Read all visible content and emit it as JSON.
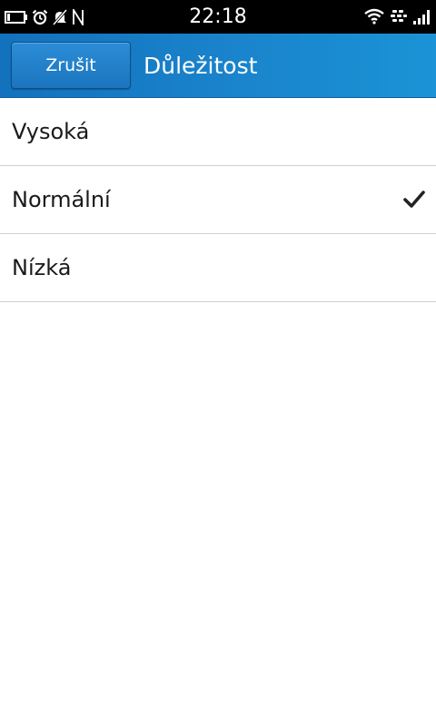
{
  "status_bar": {
    "time": "22:18",
    "left_icons": [
      "battery-icon",
      "alarm-icon",
      "notifications-muted-icon",
      "nfc-icon"
    ],
    "right_icons": [
      "wifi-icon",
      "bbm-icon",
      "signal-icon"
    ]
  },
  "header": {
    "cancel_label": "Zrušit",
    "title": "Důležitost"
  },
  "options": [
    {
      "label": "Vysoká",
      "selected": false
    },
    {
      "label": "Normální",
      "selected": true
    },
    {
      "label": "Nízká",
      "selected": false
    }
  ],
  "colors": {
    "header_bg": "#1a84cc",
    "status_bg": "#000000",
    "divider": "#cfcfcf",
    "text": "#1a1a1a"
  }
}
